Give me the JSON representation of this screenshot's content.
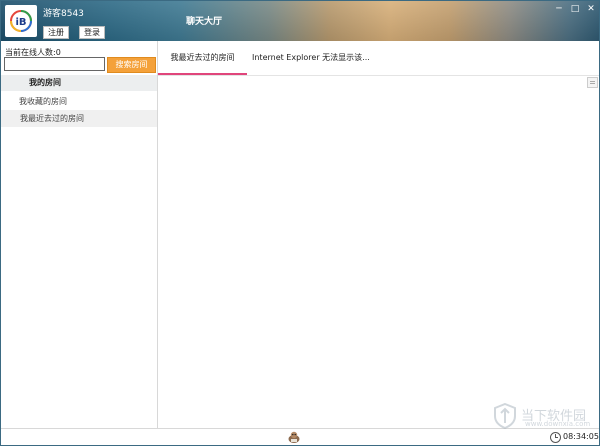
{
  "header": {
    "username": "游客8543",
    "register_label": "注册",
    "login_label": "登录",
    "hall_title": "聊天大厅",
    "logo_text": "iB",
    "window_controls": {
      "minimize": "─",
      "maximize": "□",
      "close": "✕"
    }
  },
  "sidebar": {
    "online_count": "当前在线人数:0",
    "search_placeholder": "",
    "search_button": "搜索房间",
    "section_title": "我的房间",
    "items": [
      {
        "label": "我收藏的房间"
      },
      {
        "label": "我最近去过的房间"
      }
    ]
  },
  "main": {
    "tabs": [
      {
        "label": "我最近去过的房间",
        "active": true
      },
      {
        "label": "Internet  Explorer 无法显示该..."
      }
    ]
  },
  "statusbar": {
    "time": "08:34:05"
  },
  "watermark": {
    "brand": "当下软件园",
    "url": "www.downxia.com"
  },
  "colors": {
    "accent_tab": "#e0457b",
    "search_button": "#f4a13a"
  }
}
